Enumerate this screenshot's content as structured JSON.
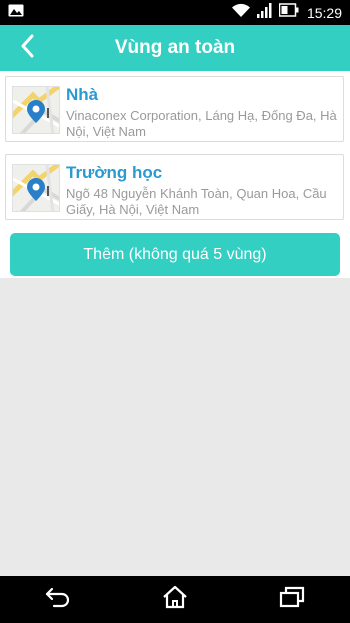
{
  "status_bar": {
    "time": "15:29",
    "icons": [
      "image-icon",
      "wifi-icon",
      "signal-icon",
      "battery-icon"
    ]
  },
  "header": {
    "title": "Vùng an toàn",
    "back_icon": "back-chevron-icon",
    "background_color": "#34cfc3"
  },
  "zones": [
    {
      "name": "Nhà",
      "address": "Vinaconex Corporation, Láng Hạ, Đống Đa, Hà Nội, Việt Nam",
      "icon": "map-pin-icon"
    },
    {
      "name": "Trường học",
      "address": "Ngõ 48 Nguyễn Khánh Toàn, Quan Hoa, Cầu Giấy, Hà Nội, Việt Nam",
      "icon": "map-pin-icon"
    }
  ],
  "add_button": {
    "label": "Thêm (không quá 5 vùng)"
  },
  "nav_bar": {
    "icons": [
      "back-icon",
      "home-icon",
      "recent-apps-icon"
    ]
  },
  "colors": {
    "accent": "#34cfc3",
    "zone_name": "#2a9ad1",
    "address": "#9a9a9a"
  }
}
